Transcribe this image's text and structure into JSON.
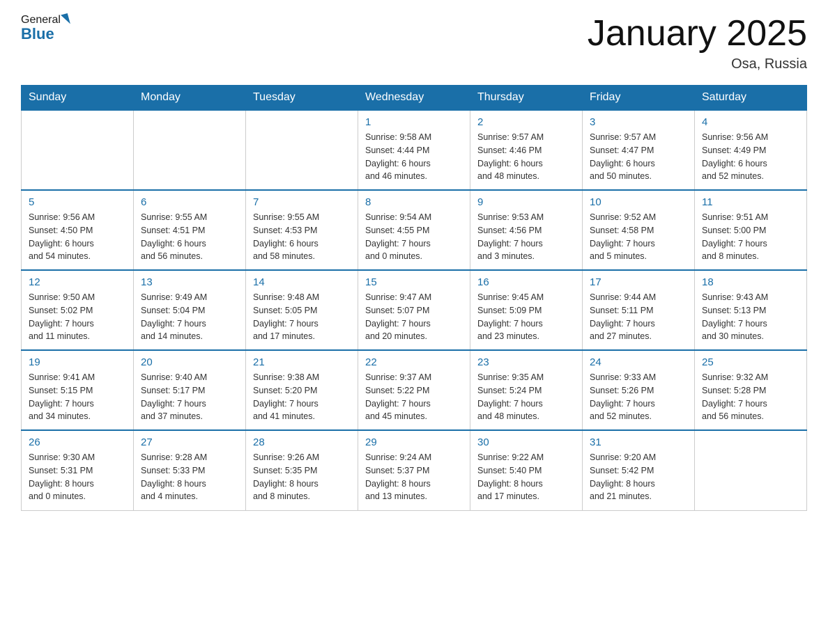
{
  "header": {
    "logo_general": "General",
    "logo_blue": "Blue",
    "title": "January 2025",
    "subtitle": "Osa, Russia"
  },
  "days_of_week": [
    "Sunday",
    "Monday",
    "Tuesday",
    "Wednesday",
    "Thursday",
    "Friday",
    "Saturday"
  ],
  "weeks": [
    [
      {
        "day": "",
        "info": ""
      },
      {
        "day": "",
        "info": ""
      },
      {
        "day": "",
        "info": ""
      },
      {
        "day": "1",
        "info": "Sunrise: 9:58 AM\nSunset: 4:44 PM\nDaylight: 6 hours\nand 46 minutes."
      },
      {
        "day": "2",
        "info": "Sunrise: 9:57 AM\nSunset: 4:46 PM\nDaylight: 6 hours\nand 48 minutes."
      },
      {
        "day": "3",
        "info": "Sunrise: 9:57 AM\nSunset: 4:47 PM\nDaylight: 6 hours\nand 50 minutes."
      },
      {
        "day": "4",
        "info": "Sunrise: 9:56 AM\nSunset: 4:49 PM\nDaylight: 6 hours\nand 52 minutes."
      }
    ],
    [
      {
        "day": "5",
        "info": "Sunrise: 9:56 AM\nSunset: 4:50 PM\nDaylight: 6 hours\nand 54 minutes."
      },
      {
        "day": "6",
        "info": "Sunrise: 9:55 AM\nSunset: 4:51 PM\nDaylight: 6 hours\nand 56 minutes."
      },
      {
        "day": "7",
        "info": "Sunrise: 9:55 AM\nSunset: 4:53 PM\nDaylight: 6 hours\nand 58 minutes."
      },
      {
        "day": "8",
        "info": "Sunrise: 9:54 AM\nSunset: 4:55 PM\nDaylight: 7 hours\nand 0 minutes."
      },
      {
        "day": "9",
        "info": "Sunrise: 9:53 AM\nSunset: 4:56 PM\nDaylight: 7 hours\nand 3 minutes."
      },
      {
        "day": "10",
        "info": "Sunrise: 9:52 AM\nSunset: 4:58 PM\nDaylight: 7 hours\nand 5 minutes."
      },
      {
        "day": "11",
        "info": "Sunrise: 9:51 AM\nSunset: 5:00 PM\nDaylight: 7 hours\nand 8 minutes."
      }
    ],
    [
      {
        "day": "12",
        "info": "Sunrise: 9:50 AM\nSunset: 5:02 PM\nDaylight: 7 hours\nand 11 minutes."
      },
      {
        "day": "13",
        "info": "Sunrise: 9:49 AM\nSunset: 5:04 PM\nDaylight: 7 hours\nand 14 minutes."
      },
      {
        "day": "14",
        "info": "Sunrise: 9:48 AM\nSunset: 5:05 PM\nDaylight: 7 hours\nand 17 minutes."
      },
      {
        "day": "15",
        "info": "Sunrise: 9:47 AM\nSunset: 5:07 PM\nDaylight: 7 hours\nand 20 minutes."
      },
      {
        "day": "16",
        "info": "Sunrise: 9:45 AM\nSunset: 5:09 PM\nDaylight: 7 hours\nand 23 minutes."
      },
      {
        "day": "17",
        "info": "Sunrise: 9:44 AM\nSunset: 5:11 PM\nDaylight: 7 hours\nand 27 minutes."
      },
      {
        "day": "18",
        "info": "Sunrise: 9:43 AM\nSunset: 5:13 PM\nDaylight: 7 hours\nand 30 minutes."
      }
    ],
    [
      {
        "day": "19",
        "info": "Sunrise: 9:41 AM\nSunset: 5:15 PM\nDaylight: 7 hours\nand 34 minutes."
      },
      {
        "day": "20",
        "info": "Sunrise: 9:40 AM\nSunset: 5:17 PM\nDaylight: 7 hours\nand 37 minutes."
      },
      {
        "day": "21",
        "info": "Sunrise: 9:38 AM\nSunset: 5:20 PM\nDaylight: 7 hours\nand 41 minutes."
      },
      {
        "day": "22",
        "info": "Sunrise: 9:37 AM\nSunset: 5:22 PM\nDaylight: 7 hours\nand 45 minutes."
      },
      {
        "day": "23",
        "info": "Sunrise: 9:35 AM\nSunset: 5:24 PM\nDaylight: 7 hours\nand 48 minutes."
      },
      {
        "day": "24",
        "info": "Sunrise: 9:33 AM\nSunset: 5:26 PM\nDaylight: 7 hours\nand 52 minutes."
      },
      {
        "day": "25",
        "info": "Sunrise: 9:32 AM\nSunset: 5:28 PM\nDaylight: 7 hours\nand 56 minutes."
      }
    ],
    [
      {
        "day": "26",
        "info": "Sunrise: 9:30 AM\nSunset: 5:31 PM\nDaylight: 8 hours\nand 0 minutes."
      },
      {
        "day": "27",
        "info": "Sunrise: 9:28 AM\nSunset: 5:33 PM\nDaylight: 8 hours\nand 4 minutes."
      },
      {
        "day": "28",
        "info": "Sunrise: 9:26 AM\nSunset: 5:35 PM\nDaylight: 8 hours\nand 8 minutes."
      },
      {
        "day": "29",
        "info": "Sunrise: 9:24 AM\nSunset: 5:37 PM\nDaylight: 8 hours\nand 13 minutes."
      },
      {
        "day": "30",
        "info": "Sunrise: 9:22 AM\nSunset: 5:40 PM\nDaylight: 8 hours\nand 17 minutes."
      },
      {
        "day": "31",
        "info": "Sunrise: 9:20 AM\nSunset: 5:42 PM\nDaylight: 8 hours\nand 21 minutes."
      },
      {
        "day": "",
        "info": ""
      }
    ]
  ]
}
